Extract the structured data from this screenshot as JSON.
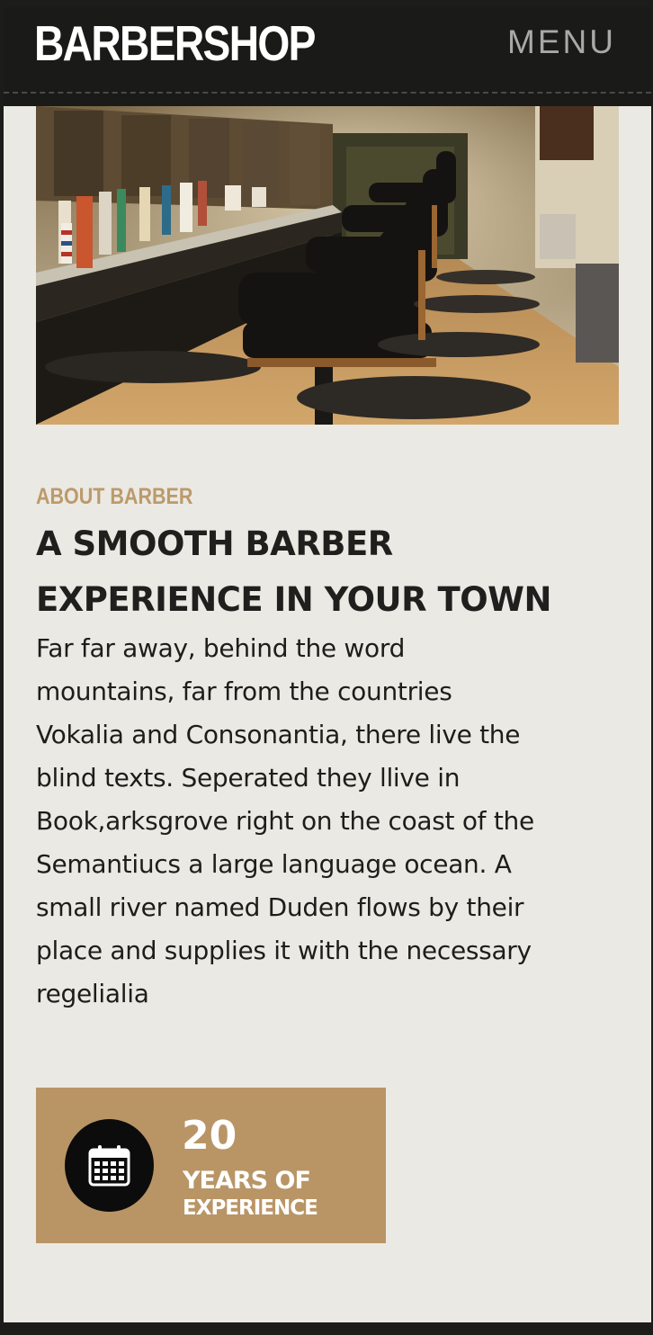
{
  "header": {
    "logo": "BARBERSHOP",
    "menu_label": "MENU"
  },
  "hero": {
    "image_subject": "barbershop interior with rows of black leather barber chairs"
  },
  "about": {
    "eyebrow": "ABOUT BARBER",
    "title_lines": [
      "A SMOOTH BARBER",
      "EXPERIENCE IN YOUR TOWN"
    ],
    "body_lines": [
      "Far far away, behind the word",
      "mountains, far from the countries",
      "Vokalia and Consonantia, there live the",
      "blind texts. Seperated they llive in",
      "Book,arksgrove right on the coast of the",
      "Semantiucs a large language ocean. A",
      "small river named Duden flows by their",
      "place and supplies it with the necessary",
      "regelialia"
    ]
  },
  "stat": {
    "icon": "calendar-icon",
    "number": "20",
    "label_line1": "YEARS OF",
    "label_line2": "EXPERIENCE"
  },
  "colors": {
    "nav_bg": "#1a1a19",
    "page_bg": "#ebe9e3",
    "accent": "#bb9a6b",
    "card_bg": "#b99566",
    "text_dark": "#1f1f1d"
  }
}
